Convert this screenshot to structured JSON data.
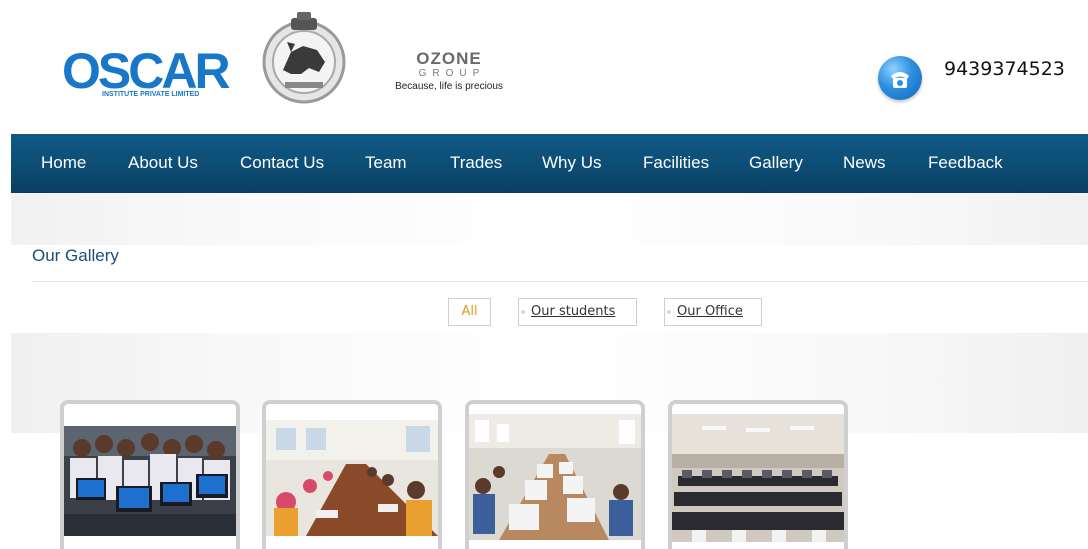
{
  "header": {
    "oscar_logo": "OSCAR",
    "oscar_subtitle": "INSTITUTE PRIVATE LIMITED",
    "emblem_icon": "odisha-emblem-icon",
    "ozone_title": "OZONE",
    "ozone_group": "GROUP",
    "ozone_tagline": "Because, life is precious",
    "phone_icon": "telephone-icon",
    "phone_number": "9439374523"
  },
  "nav": {
    "items": [
      {
        "label": "Home"
      },
      {
        "label": "About Us"
      },
      {
        "label": "Contact Us"
      },
      {
        "label": "Team"
      },
      {
        "label": "Trades"
      },
      {
        "label": "Why Us"
      },
      {
        "label": "Facilities"
      },
      {
        "label": "Gallery"
      },
      {
        "label": "News"
      },
      {
        "label": "Feedback"
      }
    ]
  },
  "gallery": {
    "title": "Our Gallery",
    "filters": [
      {
        "label": "All",
        "active": true
      },
      {
        "label": "Our students",
        "active": false
      },
      {
        "label": "Our Office",
        "active": false
      }
    ],
    "thumbnails": [
      {
        "subject": "students-with-laptops"
      },
      {
        "subject": "students-at-long-table"
      },
      {
        "subject": "computer-lab-with-students"
      },
      {
        "subject": "empty-computer-lab"
      }
    ]
  },
  "colors": {
    "nav_background": "#0d4f78",
    "brand_blue": "#1877c9",
    "active_filter": "#e69a1a",
    "gallery_title": "#1a4f7a"
  }
}
